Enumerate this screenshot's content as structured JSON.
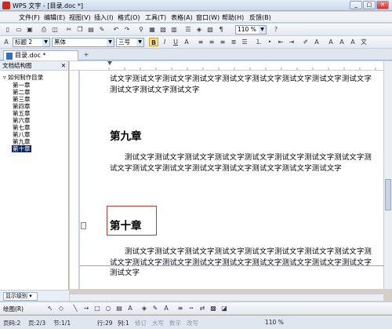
{
  "window": {
    "title": "WPS 文字 - [目录.doc *]"
  },
  "menubar": {
    "items": [
      "文件(F)",
      "编辑(E)",
      "视图(V)",
      "插入(I)",
      "格式(O)",
      "工具(T)",
      "表格(A)",
      "窗口(W)",
      "帮助(H)",
      "反馈(B)"
    ]
  },
  "toolbar": {
    "style_value": "标题 2",
    "font_value": "黑体",
    "font_size_value": "三号",
    "zoom_value": "110 %"
  },
  "tab": {
    "label": "目录.doc *"
  },
  "navpane": {
    "title": "文档结构图",
    "items": [
      "如何制作目录",
      "第一章",
      "第二章",
      "第三章",
      "第四章",
      "第五章",
      "第六章",
      "第七章",
      "第八章",
      "第九章",
      "第十章"
    ],
    "show_level_label": "显示级别"
  },
  "document": {
    "para1": "试文字测试文字测试文字测试文字测试文字测试文字测试文字测试文字测试文字测试文字测试文字测试文字",
    "heading9": "第九章",
    "para2": "测试文字测试文字测试文字测试文字测试文字测试文字测试文字测试文字测试文字测试文字测试文字测试文字测试文字测试文字测试文字测试文字",
    "heading10": "第十章",
    "para3": "测试文字测试文字测试文字测试文字测试文字测试文字测试文字测试文字测试文字测试文字测试文字测试文字测试文字测试文字测试文字测试文字测试文字测试文字"
  },
  "drawbar": {
    "label": "绘图(R)"
  },
  "status": {
    "section": "页码:2",
    "page": "页:2/3",
    "sec": "节:1/1",
    "row": "行:29",
    "col": "列:1",
    "mode1": "修订",
    "mode2": "大写",
    "mode3": "数字",
    "mode4": "改写",
    "zoom": "110 %"
  },
  "colors": {
    "accent": "#316ac5",
    "selected_nav": "#0a246a",
    "heading_box": "#c0392b"
  }
}
